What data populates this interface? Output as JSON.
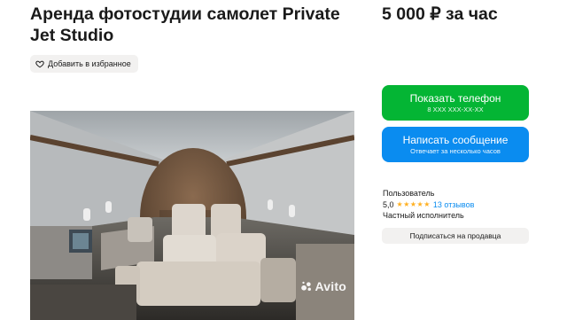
{
  "listing": {
    "title": "Аренда фотостудии самолет Private Jet Studio",
    "price": "5 000 ₽ за час",
    "favorite_label": "Добавить в избранное"
  },
  "gallery": {
    "watermark": "Avito",
    "image_description_icon": "airplane-cabin-photo"
  },
  "actions": {
    "phone_button": {
      "label": "Показать телефон",
      "sublabel": "8 XXX XXX-XX-XX"
    },
    "message_button": {
      "label": "Написать сообщение",
      "sublabel": "Отвечает за несколько часов"
    },
    "subscribe_label": "Подписаться на продавца"
  },
  "seller": {
    "name": "Пользователь",
    "rating": "5,0",
    "stars": "★★★★★",
    "reviews": "13 отзывов",
    "type": "Частный исполнитель"
  },
  "colors": {
    "phone_button": "#04b534",
    "message_button": "#0a8cf0",
    "star": "#ffb021",
    "secondary_button_bg": "#f2f1f0"
  }
}
